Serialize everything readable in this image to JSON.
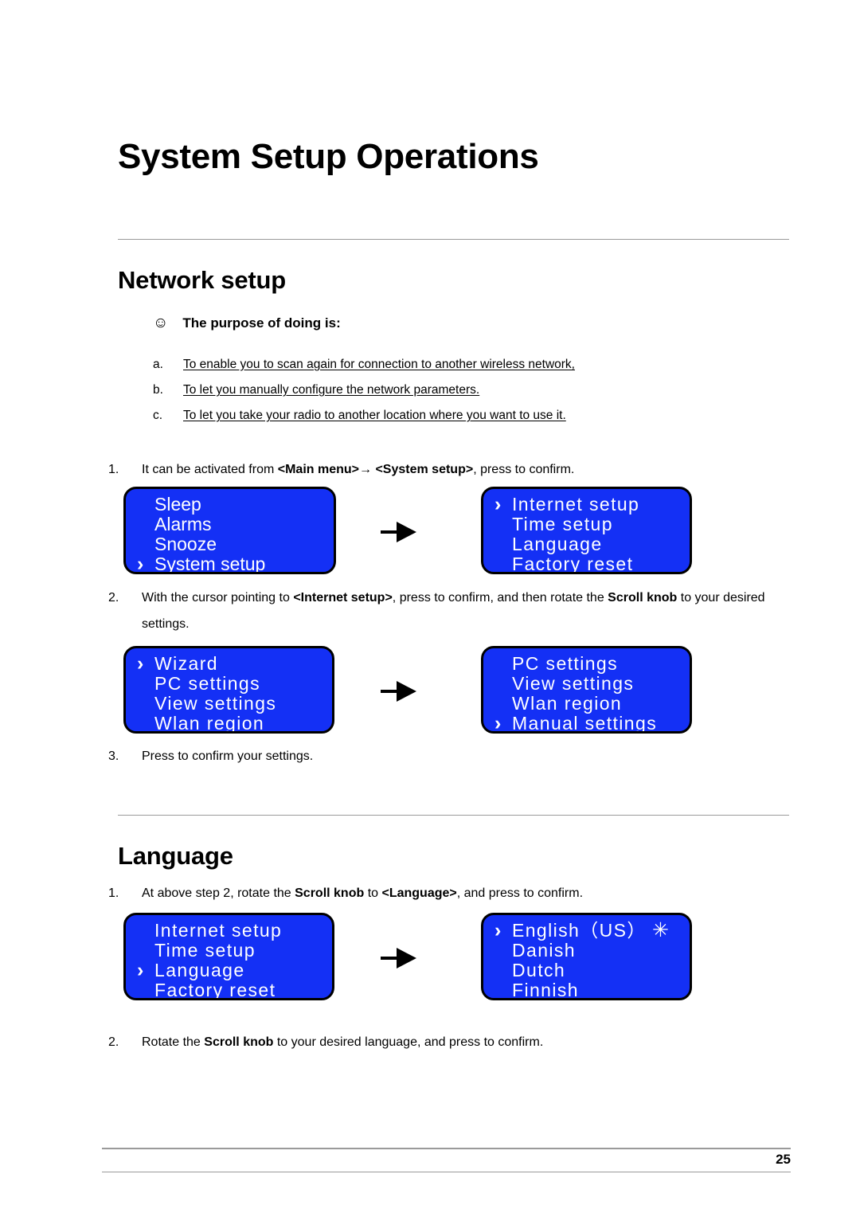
{
  "document": {
    "title": "System Setup Operations",
    "page_number": "25"
  },
  "sections": [
    {
      "heading": "Network setup",
      "purpose": {
        "icon": "smiley-face-icon",
        "glyph": "☺",
        "label": "The purpose of doing is:"
      },
      "lettered_items": [
        {
          "marker": "a.",
          "text": "To enable you to scan again for connection to another wireless network,"
        },
        {
          "marker": "b.",
          "text": "To let you manually configure the network parameters."
        },
        {
          "marker": "c.",
          "text": "To let you take your radio to another location where you want to use it."
        }
      ]
    },
    {
      "heading": "Language"
    }
  ],
  "steps": {
    "network_1": {
      "num": "1.",
      "parts": [
        {
          "t": "It can be activated from ",
          "b": false
        },
        {
          "t": "<Main menu>",
          "b": true
        },
        {
          "t": "→ ",
          "b": false
        },
        {
          "t": "<System setup>",
          "b": true
        },
        {
          "t": ", press to confirm.",
          "b": false
        }
      ]
    },
    "network_2": {
      "num": "2.",
      "parts": [
        {
          "t": "With the cursor pointing to ",
          "b": false
        },
        {
          "t": "<Internet setup>",
          "b": true
        },
        {
          "t": ", press to confirm, and then rotate the ",
          "b": false
        },
        {
          "t": "Scroll knob",
          "b": true
        },
        {
          "t": " to your desired settings.",
          "b": false
        }
      ]
    },
    "network_3": {
      "num": "3.",
      "parts": [
        {
          "t": "Press to confirm your settings.",
          "b": false
        }
      ]
    },
    "language_1": {
      "num": "1.",
      "parts": [
        {
          "t": "At above step 2, rotate the ",
          "b": false
        },
        {
          "t": "Scroll knob",
          "b": true
        },
        {
          "t": " to ",
          "b": false
        },
        {
          "t": "<Language>",
          "b": true
        },
        {
          "t": ", and press to confirm.",
          "b": false
        }
      ]
    },
    "language_2": {
      "num": "2.",
      "parts": [
        {
          "t": "Rotate the ",
          "b": false
        },
        {
          "t": "Scroll knob",
          "b": true
        },
        {
          "t": " to your desired language, and press to confirm.",
          "b": false
        }
      ]
    }
  },
  "lcd_screens": {
    "main_menu": {
      "wide": false,
      "lines": [
        {
          "text": "Sleep",
          "cursor": false,
          "star": false
        },
        {
          "text": "Alarms",
          "cursor": false,
          "star": false
        },
        {
          "text": "Snooze",
          "cursor": false,
          "star": false
        },
        {
          "text": "System setup",
          "cursor": true,
          "star": false
        }
      ]
    },
    "system_setup": {
      "wide": true,
      "lines": [
        {
          "text": "Internet setup",
          "cursor": true,
          "star": false
        },
        {
          "text": "Time setup",
          "cursor": false,
          "star": false
        },
        {
          "text": "Language",
          "cursor": false,
          "star": false
        },
        {
          "text": "Factory reset",
          "cursor": false,
          "star": false
        }
      ]
    },
    "internet_setup": {
      "wide": true,
      "lines": [
        {
          "text": "Wizard",
          "cursor": true,
          "star": false
        },
        {
          "text": "PC settings",
          "cursor": false,
          "star": false
        },
        {
          "text": "View settings",
          "cursor": false,
          "star": false
        },
        {
          "text": "Wlan region",
          "cursor": false,
          "star": false
        }
      ]
    },
    "internet_setup_scrolled": {
      "wide": true,
      "lines": [
        {
          "text": "PC settings",
          "cursor": false,
          "star": false
        },
        {
          "text": "View settings",
          "cursor": false,
          "star": false
        },
        {
          "text": "Wlan region",
          "cursor": false,
          "star": false
        },
        {
          "text": "Manual settings",
          "cursor": true,
          "star": false
        }
      ]
    },
    "system_setup_language": {
      "wide": true,
      "lines": [
        {
          "text": "Internet setup",
          "cursor": false,
          "star": false
        },
        {
          "text": "Time setup",
          "cursor": false,
          "star": false
        },
        {
          "text": "Language",
          "cursor": true,
          "star": false
        },
        {
          "text": "Factory reset",
          "cursor": false,
          "star": false
        }
      ]
    },
    "language_list": {
      "wide": true,
      "lines": [
        {
          "text": "English（US）",
          "cursor": true,
          "star": true
        },
        {
          "text": "Danish",
          "cursor": false,
          "star": false
        },
        {
          "text": "Dutch",
          "cursor": false,
          "star": false
        },
        {
          "text": "Finnish",
          "cursor": false,
          "star": false
        }
      ]
    }
  },
  "symbols": {
    "cursor": "›",
    "star": "✳",
    "arrow": "flow-arrow-right"
  }
}
